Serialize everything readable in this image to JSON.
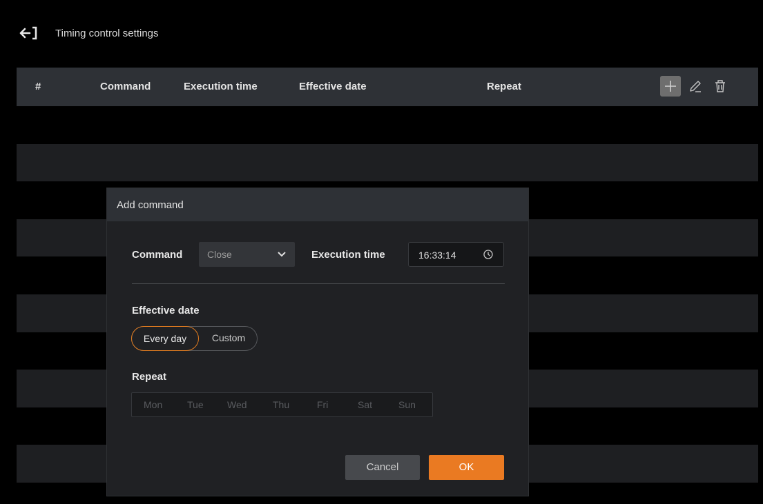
{
  "header": {
    "title": "Timing control settings"
  },
  "table": {
    "columns": {
      "index": "#",
      "command": "Command",
      "execution_time": "Execution time",
      "effective_date": "Effective date",
      "repeat": "Repeat"
    }
  },
  "dialog": {
    "title": "Add command",
    "command_label": "Command",
    "command_value": "Close",
    "execution_time_label": "Execution time",
    "execution_time_value": "16:33:14",
    "effective_date_label": "Effective date",
    "effective_date_options": [
      "Every day",
      "Custom"
    ],
    "effective_date_selected": "Every day",
    "repeat_label": "Repeat",
    "repeat_days": [
      "Mon",
      "Tue",
      "Wed",
      "Thu",
      "Fri",
      "Sat",
      "Sun"
    ],
    "cancel_label": "Cancel",
    "ok_label": "OK"
  },
  "colors": {
    "accent": "#ea7a22",
    "header_bg": "#2e3136",
    "dialog_bg": "#202124"
  }
}
